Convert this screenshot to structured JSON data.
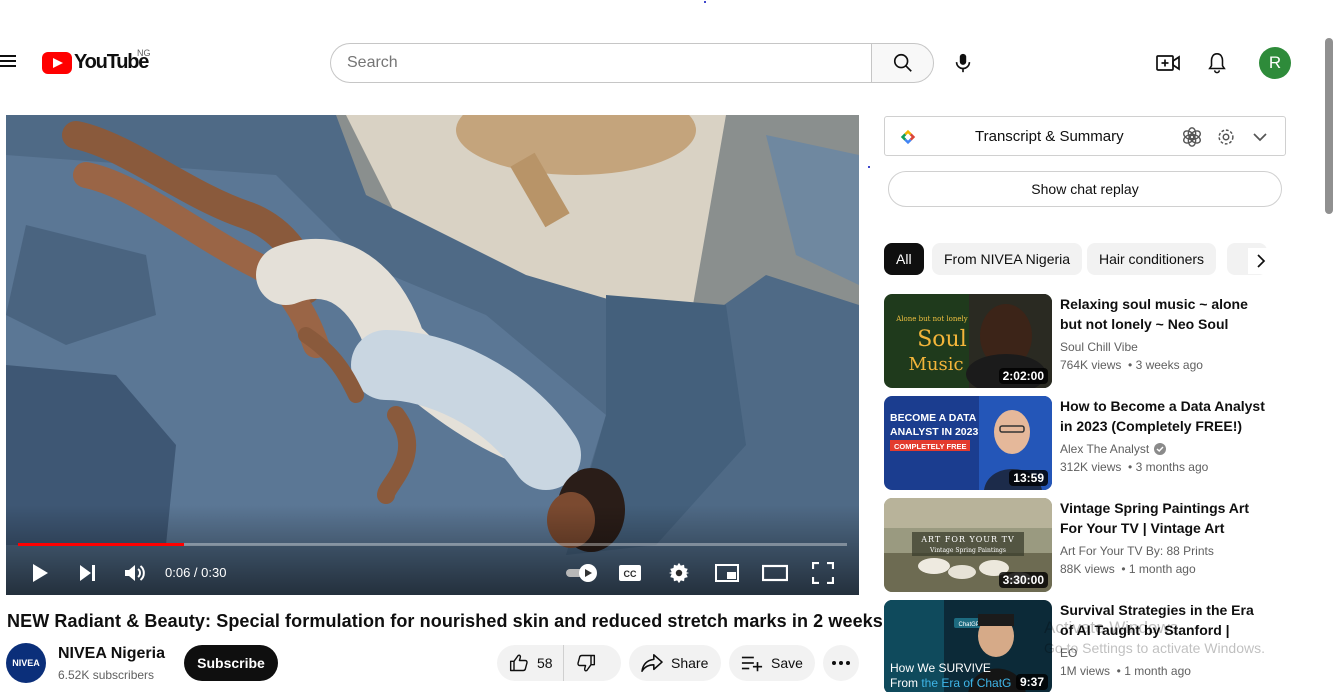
{
  "header": {
    "logo_text": "YouTube",
    "country_code": "NG",
    "search": {
      "placeholder": "Search",
      "value": ""
    },
    "avatar_letter": "R",
    "avatar_color": "#2e8b3a"
  },
  "player": {
    "time_display": "0:06 / 0:30",
    "progress": 0.2,
    "progress_color": "#ff0000"
  },
  "video": {
    "title": "NEW Radiant & Beauty: Special formulation for nourished skin and reduced stretch marks in 2 weeks.",
    "channel": {
      "name": "NIVEA Nigeria",
      "subscribers": "6.52K subscribers",
      "avatar_text": "NIVEA"
    },
    "subscribe_label": "Subscribe",
    "like_count": "58",
    "share_label": "Share",
    "save_label": "Save"
  },
  "sidebar": {
    "transcript_label": "Transcript & Summary",
    "chat_replay_label": "Show chat replay",
    "chips": [
      "All",
      "From NIVEA Nigeria",
      "Hair conditioners"
    ],
    "recommendations": [
      {
        "title": "Relaxing soul music ~ alone but not lonely ~ Neo Soul Music…",
        "channel": "Soul Chill Vibe",
        "verified": false,
        "views": "764K views",
        "age": "3 weeks ago",
        "duration": "2:02:00",
        "thumb_text_small": "Alone but not lonely",
        "thumb_text_big": "Soul",
        "thumb_text_big2": "Music"
      },
      {
        "title": "How to Become a Data Analyst in 2023 (Completely FREE!)",
        "channel": "Alex The Analyst",
        "verified": true,
        "views": "312K views",
        "age": "3 months ago",
        "duration": "13:59",
        "thumb_text_line1": "BECOME A DATA",
        "thumb_text_line2": "ANALYST IN 2023",
        "thumb_text_badge": "COMPLETELY FREE"
      },
      {
        "title": "Vintage Spring Paintings Art For Your TV | Vintage Art Slidesho…",
        "channel": "Art For Your TV By: 88 Prints",
        "verified": false,
        "views": "88K views",
        "age": "1 month ago",
        "duration": "3:30:00",
        "thumb_text_line1": "ART FOR YOUR TV",
        "thumb_text_line2": "Vintage Spring Paintings"
      },
      {
        "title": "Survival Strategies in the Era of AI Taught by Stanford | Stanfor…",
        "channel": "EO",
        "verified": false,
        "views": "1M views",
        "age": "1 month ago",
        "duration": "9:37",
        "thumb_text_line1": "How We SURVIVE",
        "thumb_text_line2a": "From ",
        "thumb_text_line2b": "the Era of ChatG",
        "thumb_text_chip": "ChatGPT"
      }
    ]
  },
  "os_watermark": {
    "line1": "Activate Windows",
    "line2": "Go to Settings to activate Windows."
  }
}
